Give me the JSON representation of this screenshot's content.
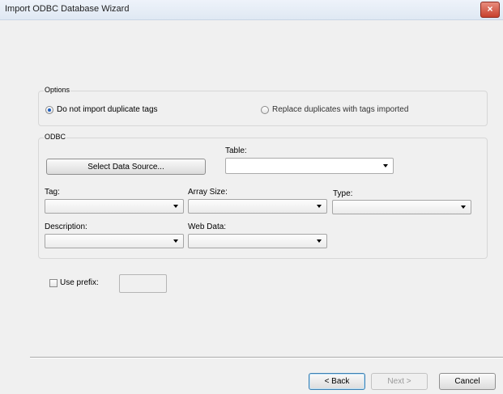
{
  "window": {
    "title": "Import ODBC Database Wizard",
    "close_glyph": "×"
  },
  "options": {
    "group_label": "Options",
    "radio_no_duplicates": "Do not import duplicate tags",
    "radio_replace": "Replace duplicates with tags imported",
    "selected": "radio_no_duplicates"
  },
  "odbc": {
    "group_label": "ODBC",
    "select_source_button": "Select Data Source...",
    "table_label": "Table:",
    "table_value": "",
    "tag_label": "Tag:",
    "tag_value": "",
    "array_size_label": "Array Size:",
    "array_size_value": "",
    "type_label": "Type:",
    "type_value": "",
    "description_label": "Description:",
    "description_value": "",
    "web_data_label": "Web Data:",
    "web_data_value": ""
  },
  "prefix": {
    "label": "Use prefix:",
    "checked": false,
    "value": ""
  },
  "footer": {
    "back": "< Back",
    "next": "Next >",
    "cancel": "Cancel"
  }
}
